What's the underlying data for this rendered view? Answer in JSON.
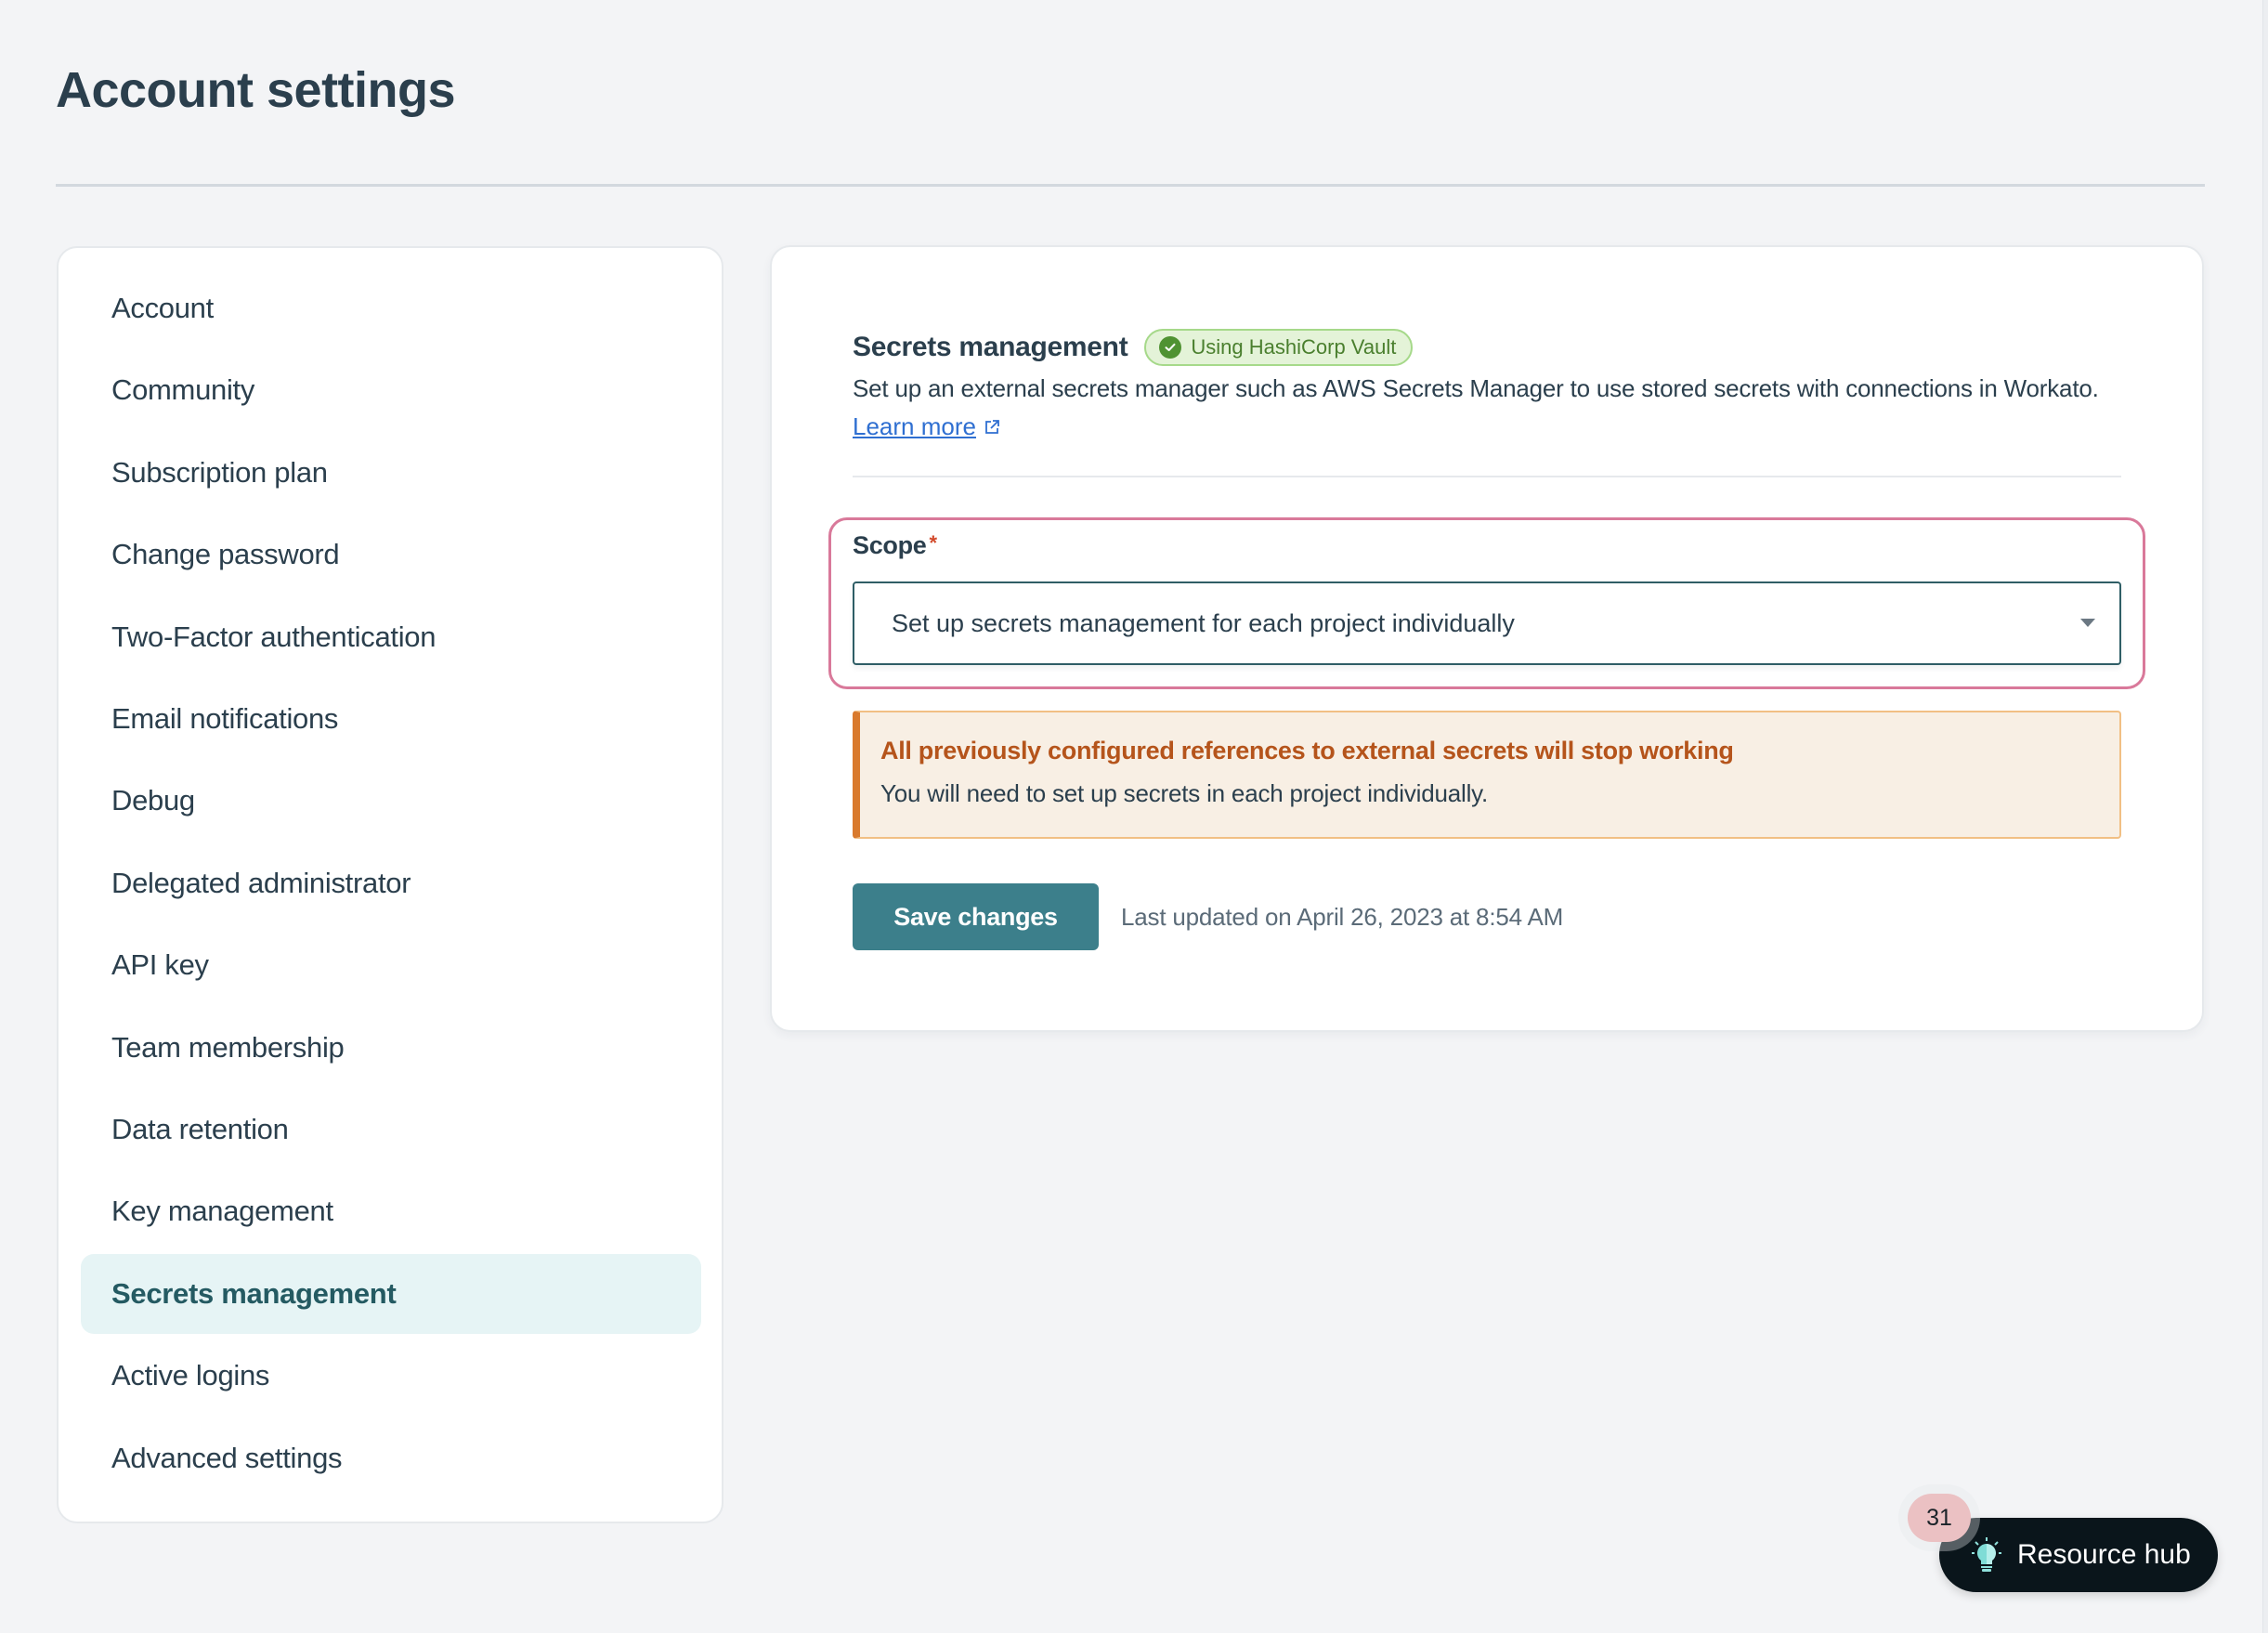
{
  "page": {
    "title": "Account settings"
  },
  "sidebar": {
    "items": [
      {
        "label": "Account",
        "active": false
      },
      {
        "label": "Community",
        "active": false
      },
      {
        "label": "Subscription plan",
        "active": false
      },
      {
        "label": "Change password",
        "active": false
      },
      {
        "label": "Two-Factor authentication",
        "active": false
      },
      {
        "label": "Email notifications",
        "active": false
      },
      {
        "label": "Debug",
        "active": false
      },
      {
        "label": "Delegated administrator",
        "active": false
      },
      {
        "label": "API key",
        "active": false
      },
      {
        "label": "Team membership",
        "active": false
      },
      {
        "label": "Data retention",
        "active": false
      },
      {
        "label": "Key management",
        "active": false
      },
      {
        "label": "Secrets management",
        "active": true
      },
      {
        "label": "Active logins",
        "active": false
      },
      {
        "label": "Advanced settings",
        "active": false
      }
    ]
  },
  "main": {
    "section_title": "Secrets management",
    "badge": {
      "label": "Using HashiCorp Vault",
      "icon": "check-circle-icon",
      "color": "#4f9232"
    },
    "description": "Set up an external secrets manager such as AWS Secrets Manager to use stored secrets with connections in Workato.",
    "learn_more": {
      "label": "Learn more",
      "icon": "external-link-icon"
    },
    "scope": {
      "label": "Scope",
      "required_mark": "*",
      "selected_value": "Set up secrets management for each project individually",
      "icon": "caret-down-icon"
    },
    "warning": {
      "title": "All previously configured references to external secrets will stop working",
      "text": "You will need to set up secrets in each project individually.",
      "accent_color": "#d97a2d"
    },
    "save_button": {
      "label": "Save changes",
      "color": "#3c7f8b"
    },
    "last_updated": "Last updated on April 26, 2023 at 8:54 AM"
  },
  "resource_hub": {
    "label": "Resource hub",
    "badge_count": "31",
    "icon": "lightbulb-icon"
  },
  "colors": {
    "highlight_border": "#d9799a",
    "active_item_bg": "#e6f4f5",
    "text_primary": "#2b3f4d"
  }
}
